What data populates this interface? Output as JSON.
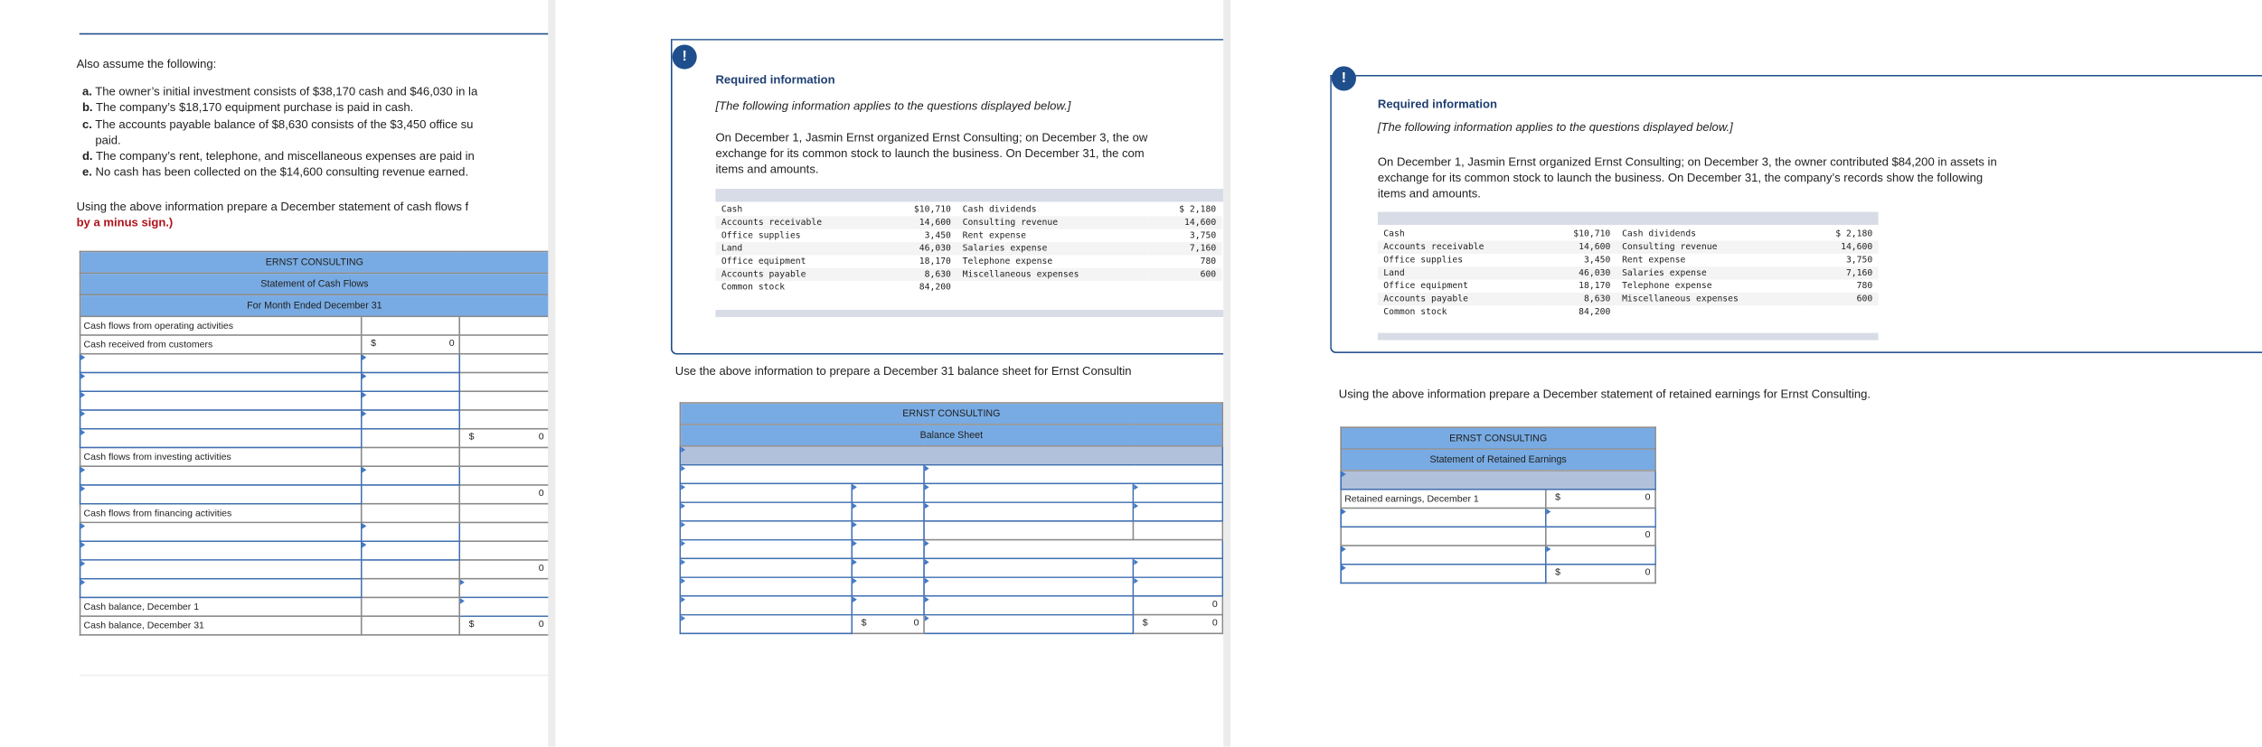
{
  "panel1": {
    "intro": "Also assume the following:",
    "items": [
      {
        "letter": "a.",
        "text": "The owner’s initial investment consists of $38,170 cash and $46,030 in la"
      },
      {
        "letter": "b.",
        "text": "The company’s $18,170 equipment purchase is paid in cash."
      },
      {
        "letter": "c.",
        "text": "The accounts payable balance of $8,630 consists of the $3,450 office su",
        "cont": "paid."
      },
      {
        "letter": "d.",
        "text": "The company’s rent, telephone, and miscellaneous expenses are paid in"
      },
      {
        "letter": "e.",
        "text": "No cash has been collected on the $14,600 consulting revenue earned."
      }
    ],
    "instruction": "Using the above information prepare a December statement of cash flows f",
    "instruction_note": "by a minus sign.)",
    "table": {
      "headers": [
        "ERNST CONSULTING",
        "Statement of Cash Flows",
        "For Month Ended December 31"
      ],
      "rows": [
        {
          "cells": [
            {
              "t": "text",
              "text": "Cash flows from operating activities"
            },
            {
              "t": "empty"
            },
            {
              "t": "empty"
            }
          ]
        },
        {
          "cells": [
            {
              "t": "text",
              "text": "Cash received from customers"
            },
            {
              "t": "value",
              "dollar": "$",
              "value": "0"
            },
            {
              "t": "empty"
            }
          ]
        },
        {
          "cells": [
            {
              "t": "input"
            },
            {
              "t": "input"
            },
            {
              "t": "empty"
            }
          ]
        },
        {
          "cells": [
            {
              "t": "input"
            },
            {
              "t": "input"
            },
            {
              "t": "empty"
            }
          ]
        },
        {
          "cells": [
            {
              "t": "input"
            },
            {
              "t": "input"
            },
            {
              "t": "empty"
            }
          ]
        },
        {
          "cells": [
            {
              "t": "input"
            },
            {
              "t": "input"
            },
            {
              "t": "empty"
            }
          ]
        },
        {
          "cells": [
            {
              "t": "input"
            },
            {
              "t": "empty",
              "tot": true
            },
            {
              "t": "value",
              "dollar": "$",
              "value": "0"
            }
          ]
        },
        {
          "cells": [
            {
              "t": "text",
              "text": "Cash flows from investing activities"
            },
            {
              "t": "empty"
            },
            {
              "t": "empty"
            }
          ]
        },
        {
          "cells": [
            {
              "t": "input"
            },
            {
              "t": "input"
            },
            {
              "t": "empty"
            }
          ]
        },
        {
          "cells": [
            {
              "t": "input"
            },
            {
              "t": "empty",
              "tot": true
            },
            {
              "t": "value",
              "value": "0"
            }
          ]
        },
        {
          "cells": [
            {
              "t": "text",
              "text": "Cash flows from financing activities"
            },
            {
              "t": "empty"
            },
            {
              "t": "empty"
            }
          ]
        },
        {
          "cells": [
            {
              "t": "input"
            },
            {
              "t": "input"
            },
            {
              "t": "empty"
            }
          ]
        },
        {
          "cells": [
            {
              "t": "input"
            },
            {
              "t": "input"
            },
            {
              "t": "empty"
            }
          ]
        },
        {
          "cells": [
            {
              "t": "input"
            },
            {
              "t": "empty",
              "tot": true
            },
            {
              "t": "value",
              "value": "0"
            }
          ]
        },
        {
          "cells": [
            {
              "t": "input"
            },
            {
              "t": "empty"
            },
            {
              "t": "input",
              "tot": true
            }
          ]
        },
        {
          "cells": [
            {
              "t": "text",
              "text": "Cash balance, December 1"
            },
            {
              "t": "empty"
            },
            {
              "t": "input"
            }
          ]
        },
        {
          "cells": [
            {
              "t": "text",
              "text": "Cash balance, December 31"
            },
            {
              "t": "empty"
            },
            {
              "t": "value",
              "dollar": "$",
              "value": "0",
              "tot": true
            }
          ]
        }
      ]
    }
  },
  "panel2": {
    "alert_icon": "!",
    "title": "Required information",
    "subtitle": "[The following information applies to the questions displayed below.]",
    "paragraph_lines": [
      "On December 1, Jasmin Ernst organized Ernst Consulting; on December 3, the ow",
      "exchange for its common stock to launch the business. On December 31, the com",
      "items and amounts."
    ],
    "instruction": "Use the above information to prepare a December 31 balance sheet for Ernst Consultin",
    "table": {
      "headers": [
        "ERNST CONSULTING",
        "Balance Sheet"
      ],
      "rows": [
        {
          "cells": [
            {
              "t": "gray",
              "span": 4
            }
          ]
        },
        {
          "cells": [
            {
              "t": "input",
              "span": 2
            },
            {
              "t": "input",
              "span": 2
            }
          ]
        },
        {
          "cells": [
            {
              "t": "input"
            },
            {
              "t": "input"
            },
            {
              "t": "input"
            },
            {
              "t": "input"
            }
          ]
        },
        {
          "cells": [
            {
              "t": "input"
            },
            {
              "t": "input"
            },
            {
              "t": "input"
            },
            {
              "t": "input"
            }
          ]
        },
        {
          "cells": [
            {
              "t": "input"
            },
            {
              "t": "input"
            },
            {
              "t": "empty"
            },
            {
              "t": "empty"
            }
          ]
        },
        {
          "cells": [
            {
              "t": "input"
            },
            {
              "t": "input"
            },
            {
              "t": "input",
              "span": 2
            }
          ]
        },
        {
          "cells": [
            {
              "t": "input"
            },
            {
              "t": "input"
            },
            {
              "t": "input"
            },
            {
              "t": "input"
            }
          ]
        },
        {
          "cells": [
            {
              "t": "input"
            },
            {
              "t": "input"
            },
            {
              "t": "input"
            },
            {
              "t": "input"
            }
          ]
        },
        {
          "cells": [
            {
              "t": "input"
            },
            {
              "t": "input"
            },
            {
              "t": "input"
            },
            {
              "t": "value",
              "value": "0",
              "tot": true
            }
          ]
        },
        {
          "cells": [
            {
              "t": "input"
            },
            {
              "t": "value",
              "dollar": "$",
              "value": "0",
              "tot": true
            },
            {
              "t": "input"
            },
            {
              "t": "value",
              "dollar": "$",
              "value": "0",
              "tot": true
            }
          ]
        }
      ]
    }
  },
  "panel3": {
    "alert_icon": "!",
    "title": "Required information",
    "subtitle": "[The following information applies to the questions displayed below.]",
    "paragraph_lines": [
      "On December 1, Jasmin Ernst organized Ernst Consulting; on December 3, the owner contributed $84,200 in assets in",
      "exchange for its common stock to launch the business. On December 31, the company’s records show the following",
      "items and amounts."
    ],
    "instruction": "Using the above information prepare a December statement of retained earnings for Ernst Consulting.",
    "table": {
      "headers": [
        "ERNST CONSULTING",
        "Statement of Retained Earnings"
      ],
      "rows": [
        {
          "cells": [
            {
              "t": "gray",
              "span": 2
            }
          ]
        },
        {
          "cells": [
            {
              "t": "text",
              "text": "Retained earnings, December 1"
            },
            {
              "t": "value",
              "dollar": "$",
              "value": "0"
            }
          ]
        },
        {
          "cells": [
            {
              "t": "input"
            },
            {
              "t": "input"
            }
          ]
        },
        {
          "cells": [
            {
              "t": "empty"
            },
            {
              "t": "value",
              "value": "0",
              "tot": true
            }
          ]
        },
        {
          "cells": [
            {
              "t": "input"
            },
            {
              "t": "input"
            }
          ]
        },
        {
          "cells": [
            {
              "t": "input"
            },
            {
              "t": "value",
              "dollar": "$",
              "value": "0",
              "tot": true
            }
          ]
        }
      ]
    }
  },
  "accounts": [
    {
      "left_label": "Cash",
      "left_value": "$10,710",
      "right_label": "Cash dividends",
      "right_value": "$ 2,180"
    },
    {
      "left_label": "Accounts receivable",
      "left_value": "14,600",
      "right_label": "Consulting revenue",
      "right_value": "14,600"
    },
    {
      "left_label": "Office supplies",
      "left_value": "3,450",
      "right_label": "Rent expense",
      "right_value": "3,750"
    },
    {
      "left_label": "Land",
      "left_value": "46,030",
      "right_label": "Salaries expense",
      "right_value": "7,160"
    },
    {
      "left_label": "Office equipment",
      "left_value": "18,170",
      "right_label": "Telephone expense",
      "right_value": "780"
    },
    {
      "left_label": "Accounts payable",
      "left_value": "8,630",
      "right_label": "Miscellaneous expenses",
      "right_value": "600"
    },
    {
      "left_label": "Common stock",
      "left_value": "84,200",
      "right_label": "",
      "right_value": ""
    }
  ],
  "colors": {
    "header_blue": "#78abe3",
    "input_border": "#3f6fb0",
    "alert_navy": "#1f4e8c",
    "note_red": "#b0121b",
    "gray_row": "#b1c0db"
  }
}
